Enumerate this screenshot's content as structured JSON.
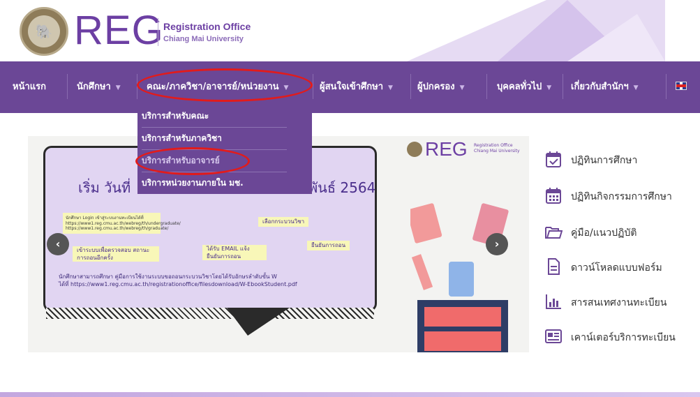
{
  "header": {
    "logo_text": "REG",
    "subtitle_1": "Registration Office",
    "subtitle_2": "Chiang Mai University"
  },
  "nav": {
    "items": [
      {
        "label": "หน้าแรก",
        "has_caret": false
      },
      {
        "label": "นักศึกษา",
        "has_caret": true
      },
      {
        "label": "คณะ/ภาควิชา/อาจารย์/หน่วยงาน",
        "has_caret": true
      },
      {
        "label": "ผู้สนใจเข้าศึกษา",
        "has_caret": true
      },
      {
        "label": "ผู้ปกครอง",
        "has_caret": true
      },
      {
        "label": "บุคคลทั่วไป",
        "has_caret": true
      },
      {
        "label": "เกี่ยวกับสำนักฯ",
        "has_caret": true
      }
    ],
    "language_flag": "uk-flag-icon"
  },
  "dropdown": {
    "items": [
      {
        "label": "บริการสำหรับคณะ"
      },
      {
        "label": "บริการสำหรับภาควิชา"
      },
      {
        "label": "บริการสำหรับอาจารย์"
      },
      {
        "label": "บริการหน่วยงานภายใน มช."
      }
    ]
  },
  "slider": {
    "title_left": "เริ่ม วันที่",
    "title_right": "พันธ์ 2564",
    "flow_note": "นักศึกษา Login เข้าสู่ระบบงานทะเบียนได้ที่ https://www1.reg.cmu.ac.th/webreg/th/undergraduate/ https://www1.reg.cmu.ac.th/webreg/th/graduate/",
    "step_select": "เลือกกระบวนวิชา",
    "step_confirm": "ยืนยันการถอน",
    "step_email": "ได้รับ EMAIL แจ้ง ยืนยันการถอน",
    "step_check": "เข้าระบบเพื่อตรวจสอบ สถานะการถอนอีกครั้ง",
    "footer_line_1": "นักศึกษาสามารถศึกษา คู่มือการใช้งานระบบขอถอนกระบวนวิชาโดยได้รับอักษรลำดับขั้น W",
    "footer_line_2": "ได้ที่ https://www1.reg.cmu.ac.th/registrationoffice/filesdownload/W-EbookStudent.pdf",
    "mini_logo": "REG",
    "mini_sub_1": "Registration Office",
    "mini_sub_2": "Chiang Mai University",
    "prev": "‹",
    "next": "›"
  },
  "side_links": [
    {
      "label": "ปฏิทินการศึกษา",
      "icon": "calendar-check-icon"
    },
    {
      "label": "ปฏิทินกิจกรรมการศึกษา",
      "icon": "calendar-grid-icon"
    },
    {
      "label": "คู่มือ/แนวปฏิบัติ",
      "icon": "folder-icon"
    },
    {
      "label": "ดาวน์โหลดแบบฟอร์ม",
      "icon": "document-icon"
    },
    {
      "label": "สารสนเทศงานทะเบียน",
      "icon": "bar-chart-icon"
    },
    {
      "label": "เคาน์เตอร์บริการทะเบียน",
      "icon": "newspaper-icon"
    }
  ],
  "colors": {
    "nav_bg": "#6b4796",
    "brand_purple": "#6c3fa3",
    "highlight_red": "#e21b1b",
    "icon_purple": "#6b4796"
  }
}
